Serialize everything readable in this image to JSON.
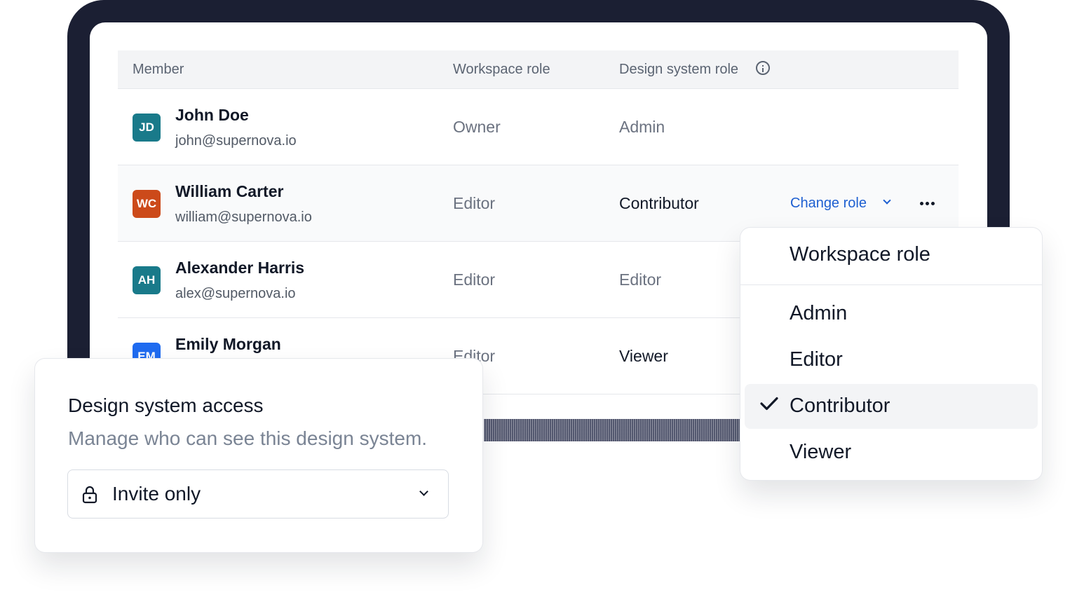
{
  "table": {
    "headers": {
      "member": "Member",
      "workspace_role": "Workspace role",
      "design_system_role": "Design system role"
    },
    "rows": [
      {
        "initials": "JD",
        "avatar_color": "#197a8a",
        "name": "John Doe",
        "email": "john@supernova.io",
        "workspace_role": "Owner",
        "ds_role": "Admin"
      },
      {
        "initials": "WC",
        "avatar_color": "#cc4a1a",
        "name": "William Carter",
        "email": "william@supernova.io",
        "workspace_role": "Editor",
        "ds_role": "Contributor",
        "action_label": "Change role"
      },
      {
        "initials": "AH",
        "avatar_color": "#197a8a",
        "name": "Alexander Harris",
        "email": "alex@supernova.io",
        "workspace_role": "Editor",
        "ds_role": "Editor"
      },
      {
        "initials": "EM",
        "avatar_color": "#1f6bf0",
        "name": "Emily Morgan",
        "email": "",
        "workspace_role": "Editor",
        "ds_role": "Viewer"
      }
    ]
  },
  "access_card": {
    "title": "Design system access",
    "subtitle": "Manage who can see this design system.",
    "select_value": "Invite only"
  },
  "role_menu": {
    "header": "Workspace role",
    "items": [
      "Admin",
      "Editor",
      "Contributor",
      "Viewer"
    ],
    "selected": "Contributor"
  },
  "colors": {
    "device_frame": "#1b1f33",
    "link": "#1d5fd1"
  }
}
